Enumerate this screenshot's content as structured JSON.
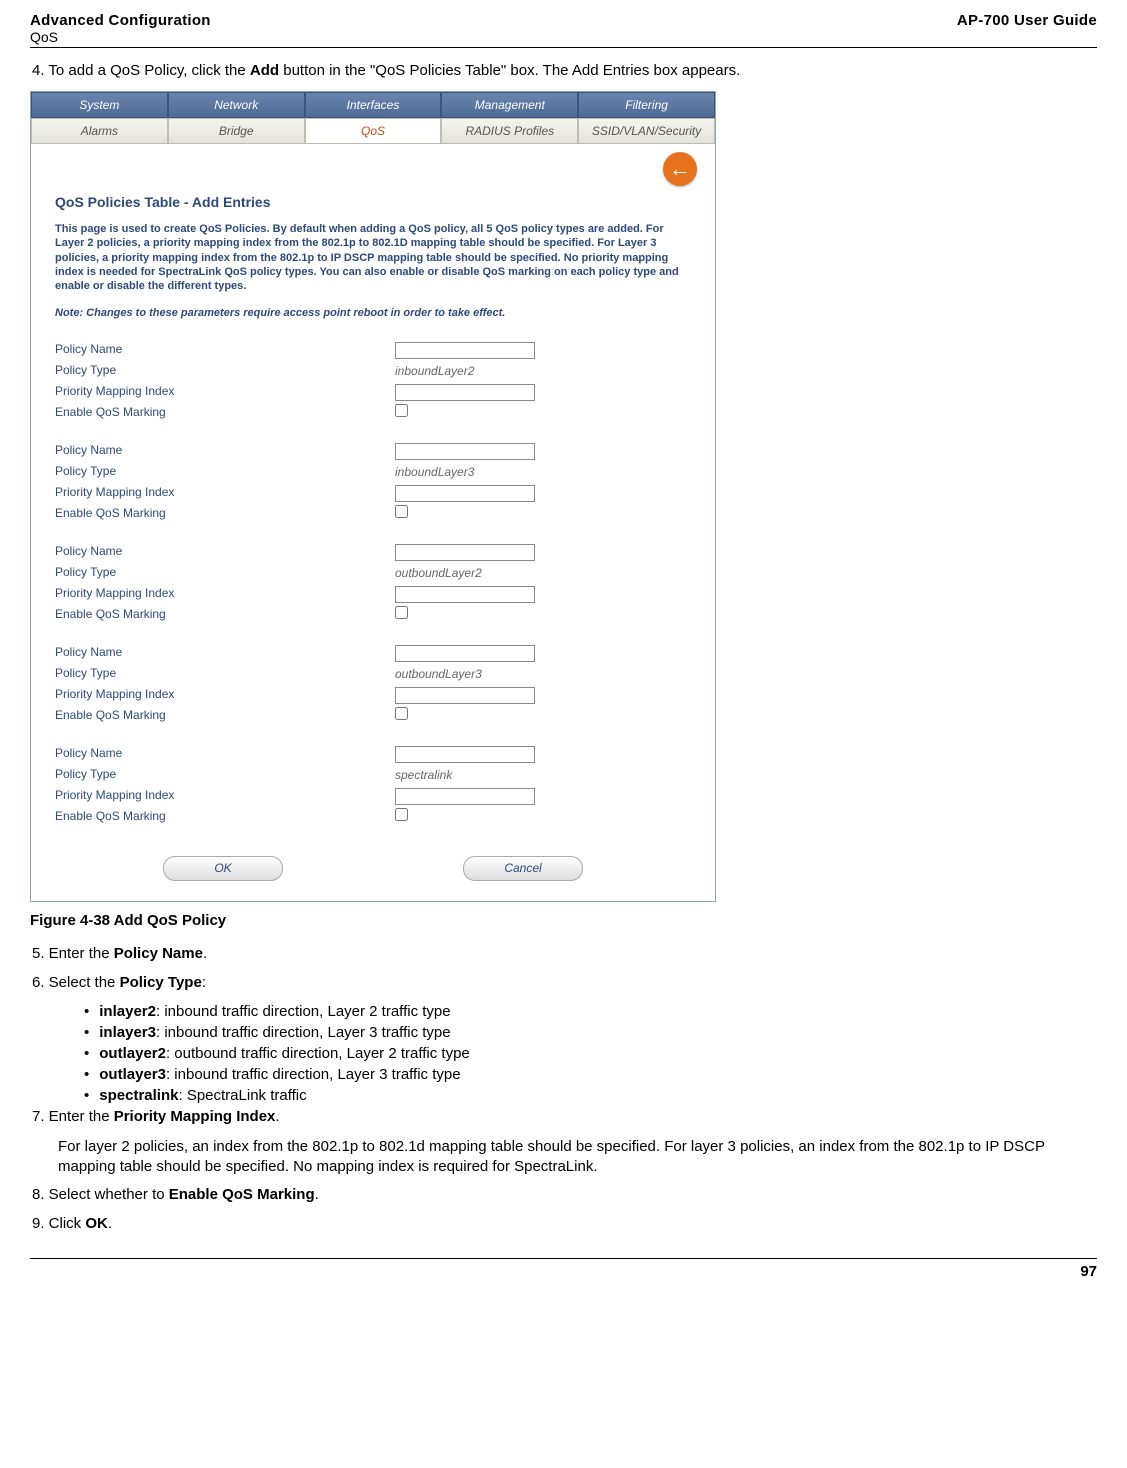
{
  "header": {
    "left_title": "Advanced Configuration",
    "left_sub": "QoS",
    "right": "AP-700 User Guide"
  },
  "steps": {
    "s4_prefix": "4.  To add a QoS Policy, click the ",
    "s4_bold": "Add",
    "s4_suffix": " button in the \"QoS Policies Table\" box. The Add Entries box appears.",
    "s5_prefix": "5.  Enter the ",
    "s5_bold": "Policy Name",
    "s5_suffix": ".",
    "s6_prefix": "6.  Select the ",
    "s6_bold": "Policy Type",
    "s6_suffix": ":",
    "s7_prefix": "7.  Enter the ",
    "s7_bold": "Priority Mapping Index",
    "s7_suffix": ".",
    "s8_prefix": "8.  Select whether to ",
    "s8_bold": "Enable QoS Marking",
    "s8_suffix": ".",
    "s9_prefix": "9.  Click ",
    "s9_bold": "OK",
    "s9_suffix": "."
  },
  "figcap": "Figure 4-38 Add QoS Policy",
  "mapping_para": "For layer 2 policies, an index from the 802.1p to 802.1d mapping table should be specified. For layer 3 policies, an index from the 802.1p to IP DSCP mapping table should be specified. No mapping index is required for SpectraLink.",
  "bullets": {
    "b1_bold": "inlayer2",
    "b1_text": ": inbound traffic direction, Layer 2 traffic type",
    "b2_bold": "inlayer3",
    "b2_text": ": inbound traffic direction, Layer 3 traffic type",
    "b3_bold": "outlayer2",
    "b3_text": ": outbound traffic direction, Layer 2 traffic type",
    "b4_bold": "outlayer3",
    "b4_text": ": inbound traffic direction, Layer 3 traffic type",
    "b5_bold": "spectralink",
    "b5_text": ": SpectraLink traffic"
  },
  "ss": {
    "tabs_outer": [
      "System",
      "Network",
      "Interfaces",
      "Management",
      "Filtering"
    ],
    "tabs_inner": [
      "Alarms",
      "Bridge",
      "QoS",
      "RADIUS Profiles",
      "SSID/VLAN/Security"
    ],
    "title": "QoS Policies Table - Add Entries",
    "desc": "This page is used to create QoS Policies. By default when adding a QoS policy, all 5 QoS policy types are added. For Layer 2 policies, a priority mapping index from the 802.1p to 802.1D mapping table should be specified. For Layer 3 policies, a priority mapping index from the 802.1p to IP DSCP mapping table should be specified. No priority mapping index is needed for SpectraLink QoS policy types. You can also enable or disable QoS marking on each policy type and enable or disable the different types.",
    "note": "Note: Changes to these parameters require access point reboot in order to take effect.",
    "labels": {
      "policy_name": "Policy Name",
      "policy_type": "Policy Type",
      "priority_mapping": "Priority Mapping Index",
      "enable_marking": "Enable QoS Marking"
    },
    "ptypes": [
      "inboundLayer2",
      "inboundLayer3",
      "outboundLayer2",
      "outboundLayer3",
      "spectralink"
    ],
    "ok": "OK",
    "cancel": "Cancel"
  },
  "page_number": "97"
}
